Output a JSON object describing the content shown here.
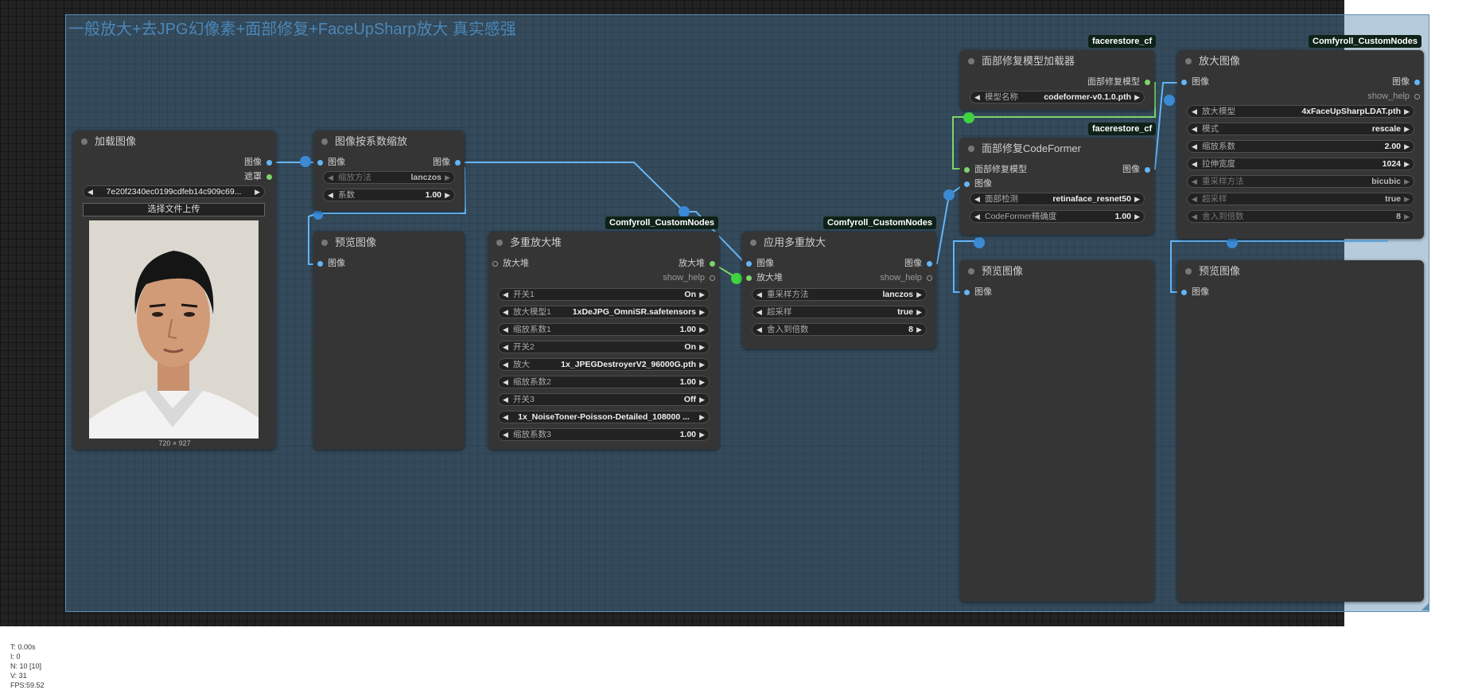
{
  "group": {
    "title": "一般放大+去JPG幻像素+面部修复+FaceUpSharp放大 真实感强"
  },
  "badges": {
    "facerestore1": "facerestore_cf",
    "facerestore2": "facerestore_cf",
    "comfyroll1": "Comfyroll_CustomNodes",
    "comfyroll2": "Comfyroll_CustomNodes",
    "comfyroll3": "Comfyroll_CustomNodes"
  },
  "load_image": {
    "title": "加载图像",
    "out_image": "图像",
    "out_mask": "遮罩",
    "file": "7e20f2340ec0199cdfeb14c909c69...",
    "upload_button": "选择文件上传",
    "dims": "720 × 927"
  },
  "scale_by": {
    "title": "图像按系数缩放",
    "in_image": "图像",
    "out_image": "图像",
    "method_label": "缩放方法",
    "method_value": "lanczos",
    "factor_label": "系数",
    "factor_value": "1.00"
  },
  "preview1": {
    "title": "预览图像",
    "in_image": "图像"
  },
  "multi_stack": {
    "title": "多重放大堆",
    "in_stack": "放大堆",
    "out_stack": "放大堆",
    "out_help": "show_help",
    "rows": [
      {
        "label": "开关1",
        "value": "On"
      },
      {
        "label": "放大模型1",
        "value": "1xDeJPG_OmniSR.safetensors"
      },
      {
        "label": "缩放系数1",
        "value": "1.00"
      },
      {
        "label": "开关2",
        "value": "On"
      },
      {
        "label": "放大",
        "value": "1x_JPEGDestroyerV2_96000G.pth"
      },
      {
        "label": "缩放系数2",
        "value": "1.00"
      },
      {
        "label": "开关3",
        "value": "Off"
      },
      {
        "label": "",
        "value": "1x_NoiseToner-Poisson-Detailed_108000 ..."
      },
      {
        "label": "缩放系数3",
        "value": "1.00"
      }
    ]
  },
  "apply_multi": {
    "title": "应用多重放大",
    "in_image": "图像",
    "in_stack": "放大堆",
    "out_image": "图像",
    "out_help": "show_help",
    "rows": [
      {
        "label": "重采样方法",
        "value": "lanczos"
      },
      {
        "label": "超采样",
        "value": "true"
      },
      {
        "label": "舍入到倍数",
        "value": "8"
      }
    ]
  },
  "face_loader": {
    "title": "面部修复模型加载器",
    "out_model": "面部修复模型",
    "model_label": "模型名称",
    "model_value": "codeformer-v0.1.0.pth"
  },
  "codeformer": {
    "title": "面部修复CodeFormer",
    "in_model": "面部修复模型",
    "in_image": "图像",
    "out_image": "图像",
    "detect_label": "面部检测",
    "detect_value": "retinaface_resnet50",
    "fidelity_label": "CodeFormer精确度",
    "fidelity_value": "1.00"
  },
  "upscale": {
    "title": "放大图像",
    "in_image": "图像",
    "out_image": "图像",
    "out_help": "show_help",
    "rows": [
      {
        "label": "放大模型",
        "value": "4xFaceUpSharpLDAT.pth"
      },
      {
        "label": "模式",
        "value": "rescale"
      },
      {
        "label": "缩放系数",
        "value": "2.00"
      },
      {
        "label": "拉伸宽度",
        "value": "1024"
      },
      {
        "label": "重采样方法",
        "value": "bicubic"
      },
      {
        "label": "超采样",
        "value": "true"
      },
      {
        "label": "舍入到倍数",
        "value": "8"
      }
    ]
  },
  "preview2": {
    "title": "预览图像",
    "in_image": "图像"
  },
  "preview3": {
    "title": "预览图像",
    "in_image": "图像"
  },
  "stats": {
    "t": "T: 0.00s",
    "i": "I: 0",
    "n": "N: 10 [10]",
    "v": "V: 31",
    "fps": "FPS:59.52"
  },
  "colors": {
    "wire_image": "#64b5f6",
    "wire_model": "#7bd56b",
    "group_bg": "#4f82aa",
    "group_title": "#4b87b8"
  }
}
